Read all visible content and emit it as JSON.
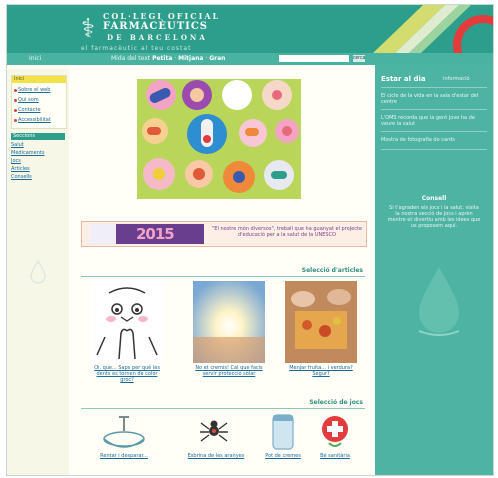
{
  "header": {
    "brand_line1": "COL·LEGI OFICIAL",
    "brand_line2": "FARMACÈUTICS",
    "brand_line3": "DE BARCELONA",
    "tagline": "el farmacèutic al teu costat"
  },
  "navbar": {
    "left_link": "Inici",
    "prefix": "Mida del text",
    "sizes": [
      "Petita",
      "Mitjana",
      "Gran"
    ],
    "search_button": "cerca"
  },
  "left_menu": {
    "top_label": "Inici",
    "links": [
      "Sobre el web",
      "Qui som",
      "Contacte",
      "Accessibilitat"
    ],
    "section_label": "Seccions",
    "items": [
      "Salut",
      "Medicaments",
      "Jocs",
      "Articles",
      "Consells"
    ]
  },
  "ad": {
    "number": "2015",
    "text": "\"El nostre món diversos\", treball que ha guanyat el projecte d'educació per a la salut de la UNESCO"
  },
  "articles": {
    "title": "Selecció d'articles",
    "items": [
      {
        "caption": "Oi, que... Saps per què les dents es tornen de color groc?"
      },
      {
        "caption": "No et cremis! Cal que facis servir protecció solar"
      },
      {
        "caption": "Menjar fruita... i verdura? Segur?"
      }
    ]
  },
  "games": {
    "title": "Selecció de jocs",
    "items": [
      {
        "caption": "Rentar i desparar..."
      },
      {
        "caption": "Esbrina de les aranyes"
      },
      {
        "caption": "Pot de cremes"
      },
      {
        "caption": "Bé sanitària"
      }
    ]
  },
  "sidebar": {
    "title": "Estar al dia",
    "subtitle": "Informació",
    "news": [
      "El cicle de la vida en la sala d'estar del centre",
      "L'OMS recorda que la gent jove ha de veure la salut",
      "Mostra de fotografia de cards"
    ],
    "advice_title": "Consell",
    "advice_text": "Si t'agraden els jocs i la salut, visita la nostra secció de jocs i aprèn mentre et divertiu amb les idees que us proposem aquí."
  }
}
